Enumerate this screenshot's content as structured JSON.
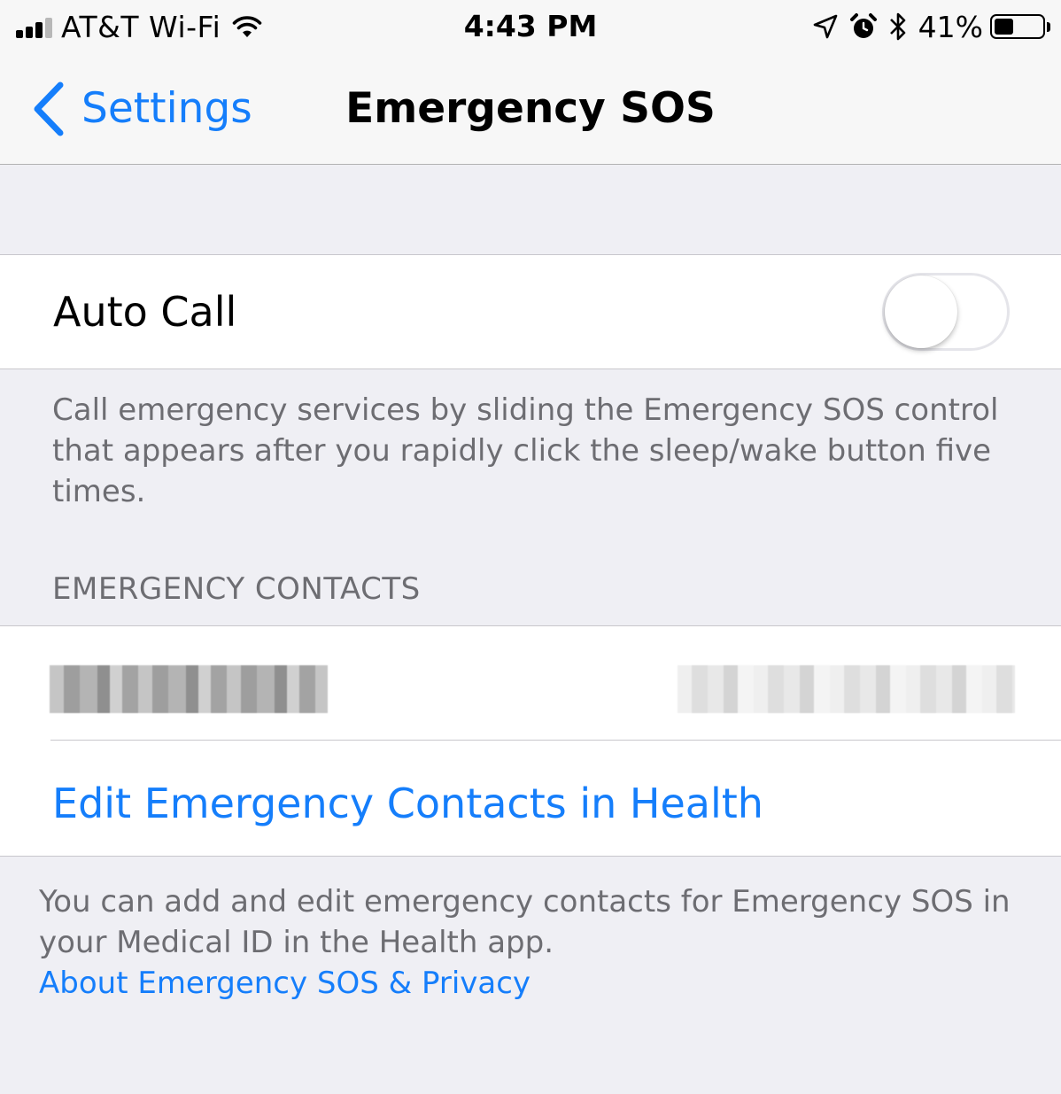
{
  "status_bar": {
    "carrier": "AT&T Wi-Fi",
    "time": "4:43 PM",
    "battery_percent": "41%",
    "battery_level": 0.41,
    "icons": [
      "signal-icon",
      "wifi-icon",
      "location-arrow-icon",
      "alarm-icon",
      "bluetooth-icon",
      "battery-icon"
    ]
  },
  "nav": {
    "back_label": "Settings",
    "title": "Emergency SOS"
  },
  "auto_call": {
    "label": "Auto Call",
    "enabled": false,
    "footer": "Call emergency services by sliding the Emergency SOS control that appears after you rapidly click the sleep/wake button five times."
  },
  "emergency_contacts": {
    "header": "EMERGENCY CONTACTS",
    "edit_link": "Edit Emergency Contacts in Health",
    "footer": "You can add and edit emergency contacts for Emergency SOS in your Medical ID in the Health app.",
    "privacy_link": "About Emergency SOS & Privacy"
  },
  "colors": {
    "accent": "#157efb",
    "background": "#efeff4",
    "footer_text": "#6d6d72"
  }
}
